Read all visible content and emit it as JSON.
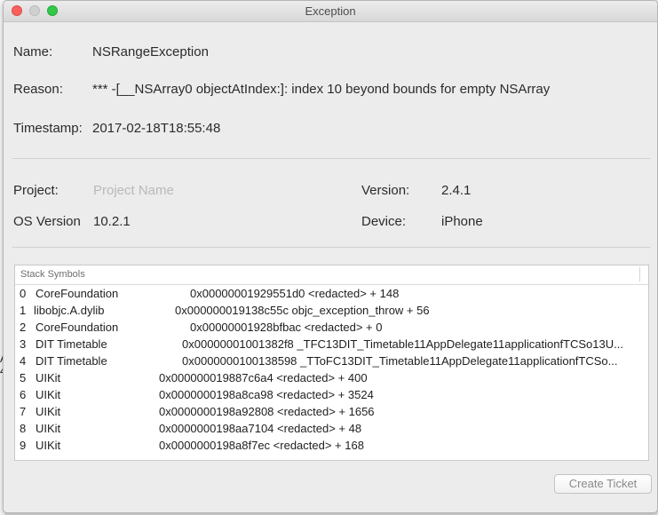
{
  "window": {
    "title": "Exception"
  },
  "exception": {
    "name_label": "Name:",
    "name_value": "NSRangeException",
    "reason_label": "Reason:",
    "reason_value": "*** -[__NSArray0 objectAtIndex:]: index 10 beyond bounds for empty NSArray",
    "timestamp_label": "Timestamp:",
    "timestamp_value": "2017-02-18T18:55:48"
  },
  "info": {
    "project_label": "Project:",
    "project_placeholder": "Project Name",
    "version_label": "Version:",
    "version_value": "2.4.1",
    "os_label": "OS Version",
    "os_value": "10.2.1",
    "device_label": "Device:",
    "device_value": "iPhone"
  },
  "stack": {
    "header": "Stack Symbols",
    "rows": [
      {
        "num": "0",
        "lib": "CoreFoundation",
        "addr": "0x00000001929551d0 <redacted> + 148"
      },
      {
        "num": "1",
        "lib": "libobjc.A.dylib",
        "addr": "0x000000019138c55c objc_exception_throw + 56"
      },
      {
        "num": "2",
        "lib": "CoreFoundation",
        "addr": "0x00000001928bfbac <redacted> + 0"
      },
      {
        "num": "3",
        "lib": "DIT Timetable",
        "addr": "0x00000001001382f8 _TFC13DIT_Timetable11AppDelegate11applicationfTCSo13U..."
      },
      {
        "num": "4",
        "lib": "DIT Timetable",
        "addr": "0x0000000100138598 _TToFC13DIT_Timetable11AppDelegate11applicationfTCSo..."
      },
      {
        "num": "5",
        "lib": "UIKit",
        "addr": "0x000000019887c6a4 <redacted> + 400"
      },
      {
        "num": "6",
        "lib": "UIKit",
        "addr": "0x0000000198a8ca98 <redacted> + 3524"
      },
      {
        "num": "7",
        "lib": "UIKit",
        "addr": "0x0000000198a92808 <redacted> + 1656"
      },
      {
        "num": "8",
        "lib": "UIKit",
        "addr": "0x0000000198aa7104 <redacted> + 48"
      },
      {
        "num": "9",
        "lib": "UIKit",
        "addr": "0x0000000198a8f7ec <redacted> + 168"
      }
    ]
  },
  "actions": {
    "create_ticket": "Create Ticket"
  },
  "background_window": {
    "sliver_a": "A",
    "sliver_4": "4"
  }
}
